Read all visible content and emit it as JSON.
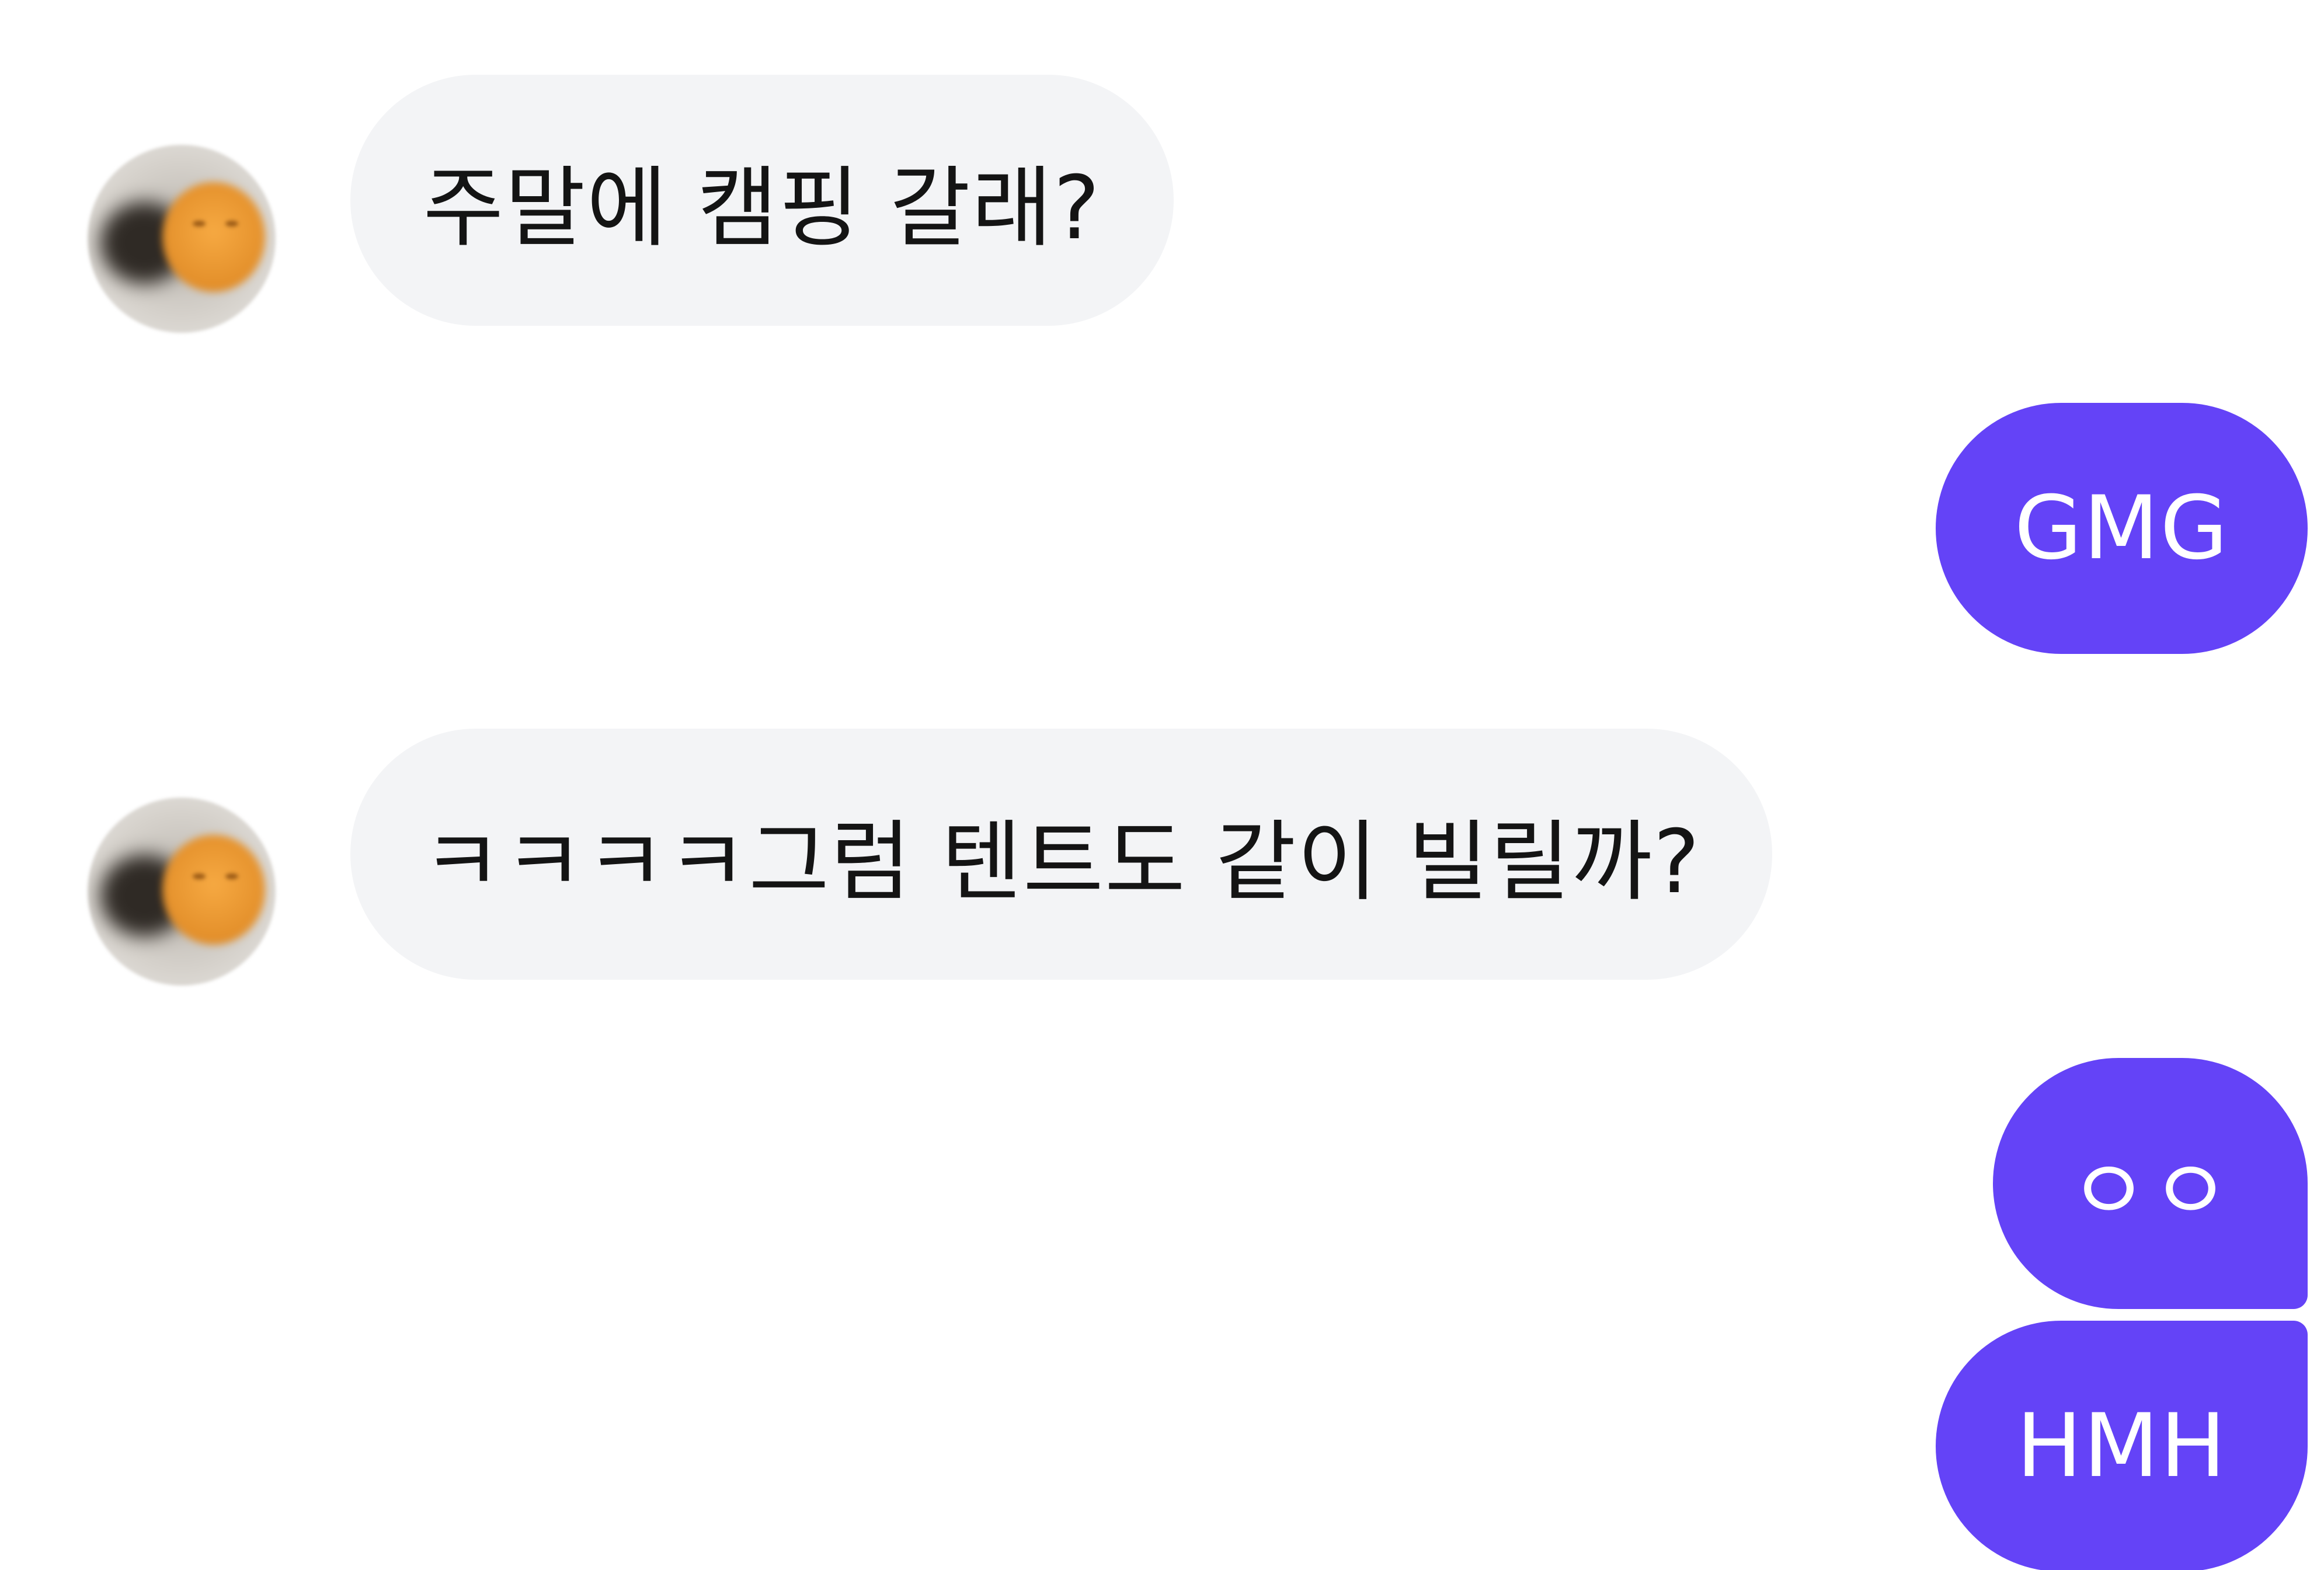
{
  "colors": {
    "background": "#ffffff",
    "incoming_bubble": "#f3f4f6",
    "incoming_text": "#141414",
    "outgoing_bubble": "#6443f7",
    "outgoing_text": "#ffffff"
  },
  "messages": [
    {
      "sender": "other",
      "text": "주말에 캠핑 갈래?"
    },
    {
      "sender": "me",
      "text": "GMG"
    },
    {
      "sender": "other",
      "text": "ㅋㅋㅋㅋ그럼 텐트도 같이 빌릴까?"
    },
    {
      "sender": "me",
      "text": "ㅇㅇ"
    },
    {
      "sender": "me",
      "text": "HMH"
    }
  ]
}
